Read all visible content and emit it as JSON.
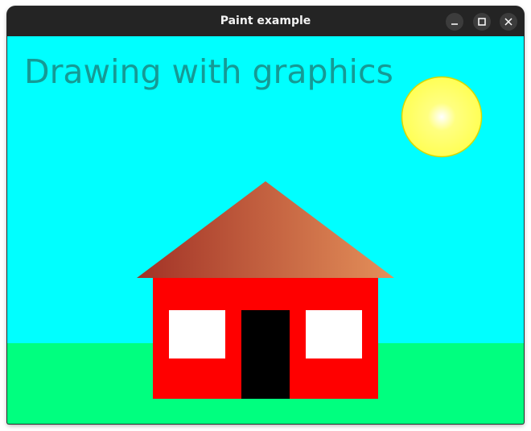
{
  "window": {
    "title": "Paint example",
    "controls": {
      "minimize_icon": "minimize-icon",
      "maximize_icon": "maximize-icon",
      "close_icon": "close-icon"
    }
  },
  "canvas": {
    "caption": "Drawing with graphics",
    "colors": {
      "sky": "#00ffff",
      "grass": "#00ff7f",
      "caption_text": "#159a95",
      "sun_center": "#ffffff",
      "sun_mid": "#ffff80",
      "sun_edge": "#ffff55",
      "sun_outline": "#d8d800",
      "roof_left": "#a23226",
      "roof_right": "#e4905a",
      "house_wall": "#ff0000",
      "window_fill": "#ffffff",
      "door_fill": "#000000"
    }
  }
}
